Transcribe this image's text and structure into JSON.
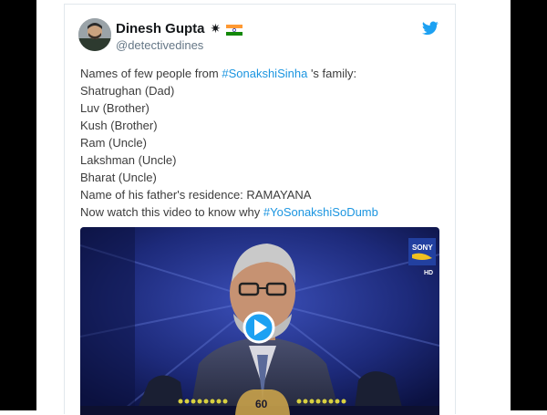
{
  "tweet": {
    "display_name": "Dinesh Gupta",
    "name_symbol": "✷",
    "handle": "@detectivedines",
    "lines": [
      {
        "pre": "Names of few people from ",
        "tag": "#SonakshiSinha",
        "post": " 's family:"
      },
      {
        "pre": "Shatrughan (Dad)"
      },
      {
        "pre": "Luv (Brother)"
      },
      {
        "pre": "Kush (Brother)"
      },
      {
        "pre": "Ram (Uncle)"
      },
      {
        "pre": "Lakshman (Uncle)"
      },
      {
        "pre": "Bharat (Uncle)"
      },
      {
        "pre": "Name of his father's residence: RAMAYANA"
      },
      {
        "pre": "Now watch this video to know why ",
        "tag": "#YoSonakshiSoDumb"
      }
    ],
    "icons": {
      "flag": "india-flag-icon",
      "bird": "twitter-bird-icon",
      "play": "play-icon"
    }
  },
  "video": {
    "channel_logo": "SONY",
    "channel_sub": "HD",
    "score_display": "60"
  },
  "colors": {
    "hashtag": "#1b95e0",
    "text": "#3c3c3c",
    "handle": "#657786",
    "twitter_blue": "#1da1f2"
  }
}
